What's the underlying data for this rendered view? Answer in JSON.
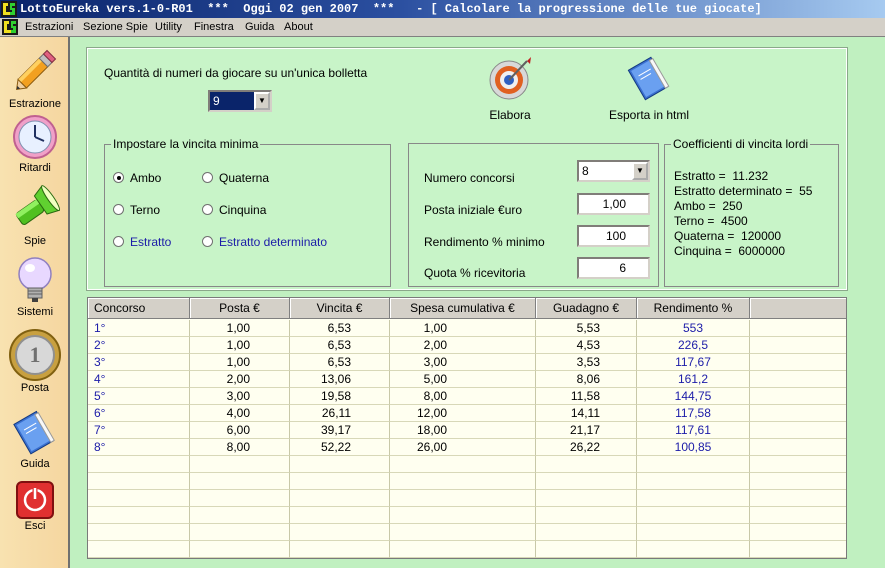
{
  "window": {
    "title": "LottoEureka vers.1-0-R01  ***  Oggi 02 gen 2007  ***   - [ Calcolare la progressione delle tue giocate]"
  },
  "menu": [
    "Estrazioni",
    "Sezione Spie",
    "Utility",
    "Finestra",
    "Guida",
    "About"
  ],
  "sidebar": {
    "items": [
      {
        "label": "Estrazione",
        "icon": "pencil-icon"
      },
      {
        "label": "Ritardi",
        "icon": "clock-icon"
      },
      {
        "label": "Spie",
        "icon": "flashlight-icon"
      },
      {
        "label": "Sistemi",
        "icon": "lightbulb-icon"
      },
      {
        "label": "Posta",
        "icon": "euro-coin-icon"
      },
      {
        "label": "Guida",
        "icon": "book-icon"
      },
      {
        "label": "Esci",
        "icon": "power-icon"
      }
    ]
  },
  "form": {
    "qty_label": "Quantità di numeri da giocare su un'unica bolletta",
    "qty_value": "9",
    "elabora_label": "Elabora",
    "esporta_label": "Esporta in html",
    "vincita": {
      "legend": "Impostare la vincita minima",
      "options": [
        "Ambo",
        "Quaterna",
        "Terno",
        "Cinquina",
        "Estratto",
        "Estratto determinato"
      ],
      "selected": "Ambo"
    },
    "params": {
      "concorsi_label": "Numero concorsi",
      "concorsi_value": "8",
      "posta_label": "Posta iniziale €uro",
      "posta_value": "1,00",
      "rendimento_label": "Rendimento % minimo",
      "rendimento_value": "100",
      "quota_label": "Quota % ricevitoria",
      "quota_value": "6"
    },
    "coefficienti": {
      "legend": "Coefficienti di vincita lordi",
      "lines": [
        "Estratto =  11.232",
        "Estratto determinato =  55",
        "Ambo =  250",
        "Terno =  4500",
        "Quaterna =  120000",
        "Cinquina =  6000000"
      ]
    }
  },
  "table": {
    "columns": [
      "Concorso",
      "Posta €",
      "Vincita €",
      "Spesa cumulativa €",
      "Guadagno €",
      "Rendimento %"
    ],
    "rows": [
      [
        "1°",
        "1,00",
        "6,53",
        "1,00",
        "5,53",
        "553"
      ],
      [
        "2°",
        "1,00",
        "6,53",
        "2,00",
        "4,53",
        "226,5"
      ],
      [
        "3°",
        "1,00",
        "6,53",
        "3,00",
        "3,53",
        "117,67"
      ],
      [
        "4°",
        "2,00",
        "13,06",
        "5,00",
        "8,06",
        "161,2"
      ],
      [
        "5°",
        "3,00",
        "19,58",
        "8,00",
        "11,58",
        "144,75"
      ],
      [
        "6°",
        "4,00",
        "26,11",
        "12,00",
        "14,11",
        "117,58"
      ],
      [
        "7°",
        "6,00",
        "39,17",
        "18,00",
        "21,17",
        "117,61"
      ],
      [
        "8°",
        "8,00",
        "52,22",
        "26,00",
        "26,22",
        "100,85"
      ]
    ]
  },
  "colors": {
    "panel_bg": "#c8f4c8",
    "grid_bg": "#fffff0",
    "blue_text": "#1c1ca8",
    "sidebar_bg": "#f5d6a0"
  }
}
